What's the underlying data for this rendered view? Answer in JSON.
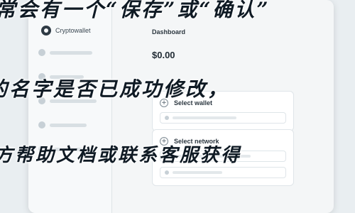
{
  "app": {
    "brand_name": "Cryptowallet",
    "left_items": [
      "",
      "",
      "",
      "",
      ""
    ]
  },
  "main": {
    "title": "Dashboard",
    "balance_value": "$0.00",
    "cards": [
      {
        "title": "Select wallet",
        "icon": "plus-icon"
      },
      {
        "title": "Select network",
        "icon": "plus-icon"
      }
    ]
  },
  "overlay": {
    "line1": "常会有一个“保存”或“确认”",
    "line2": "的名字是否已成功修改，",
    "line3": "方帮助文档或联系客服获得"
  }
}
